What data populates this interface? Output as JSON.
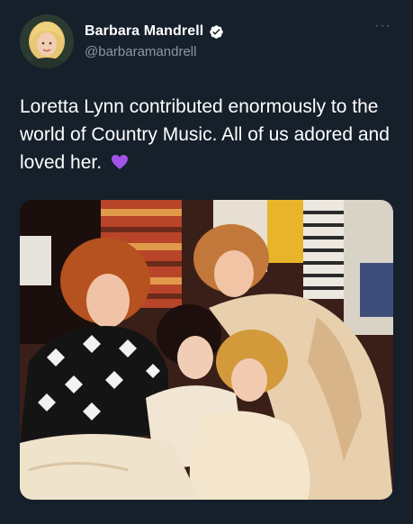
{
  "author": {
    "display_name": "Barbara Mandrell",
    "handle": "@barbaramandrell",
    "verified": true,
    "avatar_icon": "profile-photo"
  },
  "more_icon": "more-options-icon",
  "tweet": {
    "text": "Loretta Lynn contributed enormously to the world of Country Music. All of us adored and loved her.",
    "emoji": "purple-heart"
  },
  "media": {
    "kind": "photo"
  },
  "colors": {
    "background": "#15202b",
    "text_primary": "#ffffff",
    "text_secondary": "#8b98a5",
    "verified_blue": "#1d9bf0",
    "emoji_purple": "#a353e8"
  }
}
